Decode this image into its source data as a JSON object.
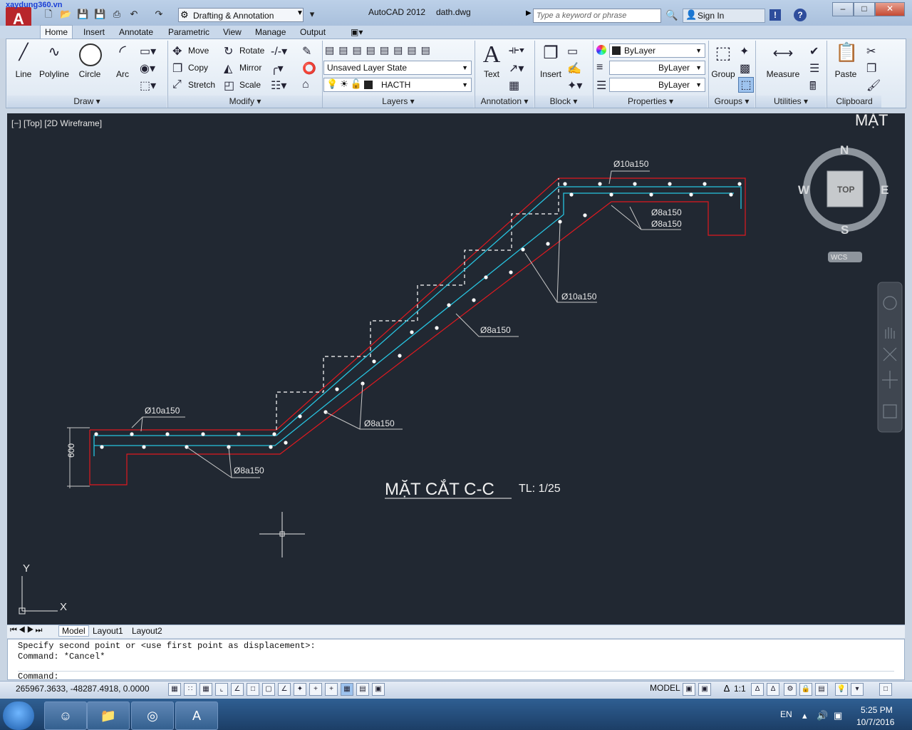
{
  "watermark": "xaydung360.vn",
  "title_bar": {
    "workspace": "Drafting & Annotation",
    "app_name": "AutoCAD 2012",
    "file_name": "dath.dwg",
    "search_placeholder": "Type a keyword or phrase",
    "sign_in": "Sign In",
    "logo": "A"
  },
  "ribbon_tabs": [
    "Home",
    "Insert",
    "Annotate",
    "Parametric",
    "View",
    "Manage",
    "Output"
  ],
  "draw": {
    "title": "Draw",
    "line": "Line",
    "polyline": "Polyline",
    "circle": "Circle",
    "arc": "Arc"
  },
  "modify": {
    "title": "Modify",
    "move": "Move",
    "rotate": "Rotate",
    "copy": "Copy",
    "mirror": "Mirror",
    "stretch": "Stretch",
    "scale": "Scale"
  },
  "layers": {
    "title": "Layers",
    "layer_state": "Unsaved Layer State",
    "current_layer": "HACTH"
  },
  "annotation": {
    "title": "Annotation",
    "text": "Text"
  },
  "block": {
    "title": "Block",
    "insert": "Insert"
  },
  "properties": {
    "title": "Properties",
    "color": "ByLayer",
    "linetype": "ByLayer",
    "lineweight": "ByLayer"
  },
  "groups": {
    "title": "Groups",
    "group": "Group"
  },
  "utilities": {
    "title": "Utilities",
    "measure": "Measure"
  },
  "clipboard": {
    "title": "Clipboard",
    "paste": "Paste"
  },
  "viewport_label": "[−] [Top] [2D Wireframe]",
  "drawing": {
    "section_title": "MẶT CẮT C-C",
    "scale_note": "TL: 1/25",
    "partial_text": "MẶT",
    "dim_600": "600",
    "labels": {
      "l1": "Ø10a150",
      "l2": "Ø8a150",
      "l3": "Ø8a150",
      "l4": "Ø8a150",
      "l5": "Ø10a150",
      "l6": "Ø10a150",
      "l7": "Ø8a150",
      "l8": "Ø8a150",
      "l9": "Ø8a150"
    }
  },
  "viewcube": {
    "n": "N",
    "s": "S",
    "e": "E",
    "w": "W",
    "top": "TOP",
    "wcs": "WCS"
  },
  "ucs": {
    "x": "X",
    "y": "Y"
  },
  "layout_tabs": [
    "Model",
    "Layout1",
    "Layout2"
  ],
  "command": {
    "history1": "Specify second point or <use first point as displacement>:",
    "history2": "Command: *Cancel*",
    "prompt": "Command:"
  },
  "status": {
    "coords": "265967.3633, -48287.4918, 0.0000",
    "model": "MODEL",
    "scale": "1:1"
  },
  "taskbar": {
    "lang": "EN",
    "time": "5:25 PM",
    "date": "10/7/2016"
  }
}
